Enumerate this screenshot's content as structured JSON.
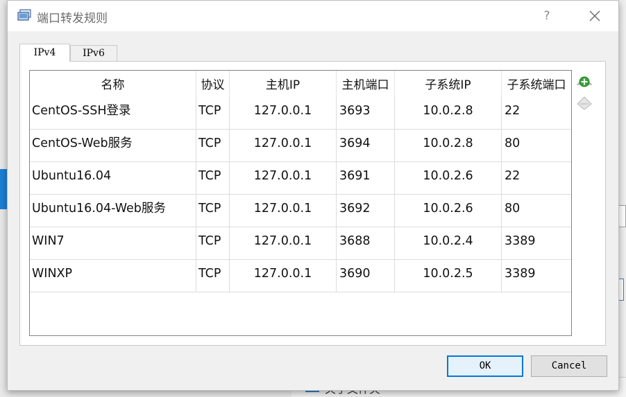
{
  "background": {
    "bottom_fragment_text": "关于文件夹"
  },
  "dialog": {
    "title": "端口转发规则",
    "help_label": "?",
    "tabs": [
      {
        "label": "IPv4",
        "selected": true
      },
      {
        "label": "IPv6",
        "selected": false
      }
    ],
    "table": {
      "columns": [
        "名称",
        "协议",
        "主机IP",
        "主机端口",
        "子系统IP",
        "子系统端口"
      ],
      "rows": [
        {
          "name": "CentOS-SSH登录",
          "protocol": "TCP",
          "host_ip": "127.0.0.1",
          "host_port": "3693",
          "guest_ip": "10.0.2.8",
          "guest_port": "22"
        },
        {
          "name": "CentOS-Web服务",
          "protocol": "TCP",
          "host_ip": "127.0.0.1",
          "host_port": "3694",
          "guest_ip": "10.0.2.8",
          "guest_port": "80"
        },
        {
          "name": "Ubuntu16.04",
          "protocol": "TCP",
          "host_ip": "127.0.0.1",
          "host_port": "3691",
          "guest_ip": "10.0.2.6",
          "guest_port": "22"
        },
        {
          "name": "Ubuntu16.04-Web服务",
          "protocol": "TCP",
          "host_ip": "127.0.0.1",
          "host_port": "3692",
          "guest_ip": "10.0.2.6",
          "guest_port": "80"
        },
        {
          "name": "WIN7",
          "protocol": "TCP",
          "host_ip": "127.0.0.1",
          "host_port": "3688",
          "guest_ip": "10.0.2.4",
          "guest_port": "3389"
        },
        {
          "name": "WINXP",
          "protocol": "TCP",
          "host_ip": "127.0.0.1",
          "host_port": "3690",
          "guest_ip": "10.0.2.5",
          "guest_port": "3389"
        }
      ]
    },
    "side_icons": [
      "add-rule-icon",
      "remove-rule-icon"
    ],
    "buttons": {
      "ok": "OK",
      "cancel": "Cancel"
    }
  },
  "colors": {
    "accent": "#0078d7",
    "add_icon_green": "#3aa53a"
  }
}
